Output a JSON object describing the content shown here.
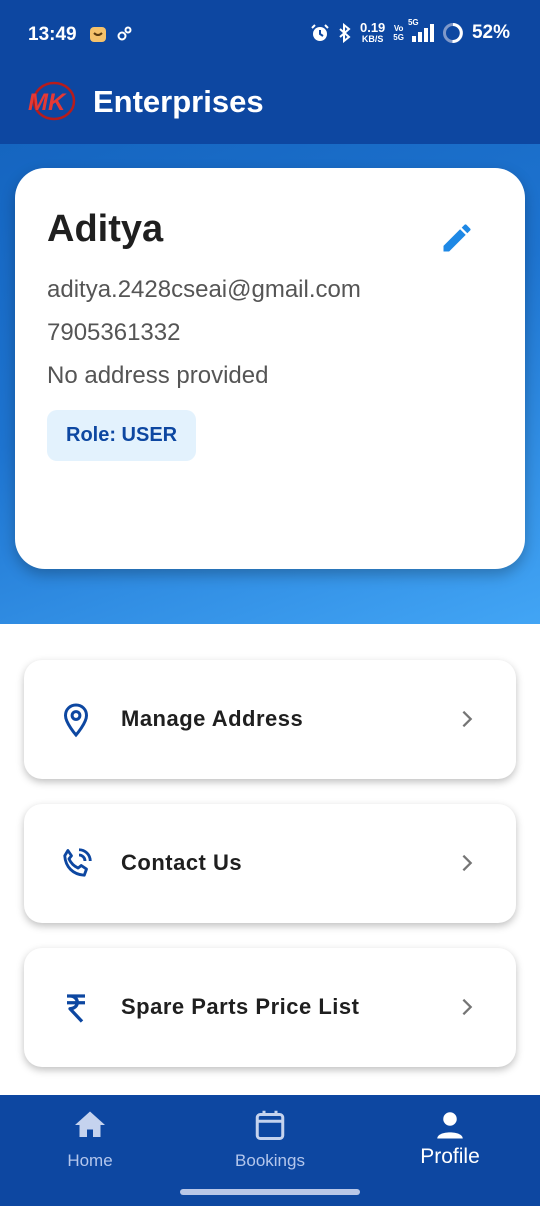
{
  "status_bar": {
    "time": "13:49",
    "speed_value": "0.19",
    "speed_unit": "KB/S",
    "network_top": "Vo",
    "network_bottom": "5G",
    "signal_label": "5G",
    "battery": "52%"
  },
  "app_bar": {
    "logo_text": "MK",
    "title": "Enterprises"
  },
  "profile": {
    "name": "Aditya",
    "email": "aditya.2428cseai@gmail.com",
    "phone": "7905361332",
    "address": "No address provided",
    "role": "Role: USER"
  },
  "menu": [
    {
      "label": "Manage Address",
      "icon": "location-pin-icon"
    },
    {
      "label": "Contact Us",
      "icon": "phone-call-icon"
    },
    {
      "label": "Spare Parts Price List",
      "icon": "rupee-icon"
    }
  ],
  "bottom_nav": [
    {
      "label": "Home",
      "icon": "home-icon",
      "active": false
    },
    {
      "label": "Bookings",
      "icon": "calendar-icon",
      "active": false
    },
    {
      "label": "Profile",
      "icon": "person-icon",
      "active": true
    }
  ],
  "colors": {
    "primary": "#0d47a1",
    "accent": "#1e88e5",
    "gradient_end": "#42a5f5",
    "logo_red": "#e53935"
  }
}
